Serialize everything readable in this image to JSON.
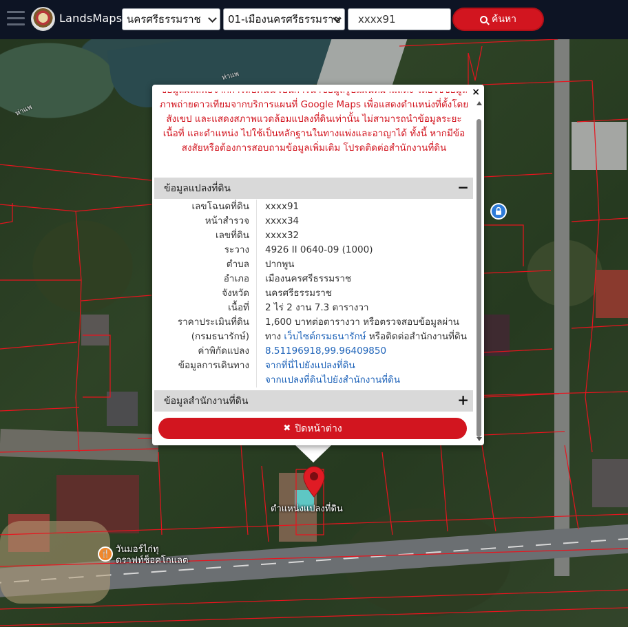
{
  "header": {
    "brand": "LandsMaps",
    "province_select": "นครศรีธรรมราช",
    "amphoe_select": "01-เมืองนครศรีธรรมราช",
    "search_value": "xxxx91",
    "search_button": "ค้นหา"
  },
  "map": {
    "parcel_marker_label": "ตำแหน่งแปลงที่ดิน",
    "poi_food_label_line1": "วันมอร์ไก่ทุ",
    "poi_food_label_line2": "ดราฟท์ช็อคโกแลต",
    "poi_food_icon": "fork-knife-icon",
    "poi_lock_icon": "lock-icon",
    "street_label_1": "ท่าแพ",
    "street_label_2": "ท่าแพ",
    "colors": {
      "parcel_lines": "#e8141e",
      "marker": "#e01b24",
      "poi_food": "#f0882c",
      "poi_blue": "#2e7bd8"
    }
  },
  "popup": {
    "disclaimer": "ข้อมูลผลลัพธ์จากการสืบค้นนี้ เป็นการนำข้อมูลรูปแผนที่มาแสดง โดยใช้ข้อมูลภาพถ่ายดาวเทียมจากบริการแผนที่ Google Maps เพื่อแสดงตำแหน่งที่ตั้งโดยสังเขป และแสดงสภาพแวดล้อมแปลงที่ดินเท่านั้น ไม่สามารถนำข้อมูลระยะ เนื้อที่ และตำแหน่ง ไปใช้เป็นหลักฐานในทางแพ่งและอาญาได้ ทั้งนี้ หากมีข้อสงสัยหรือต้องการสอบถามข้อมูลเพิ่มเติม โปรดติดต่อสำนักงานที่ดิน",
    "section_parcel": "ข้อมูลแปลงที่ดิน",
    "section_parcel_sign": "−",
    "section_office": "ข้อมูลสำนักงานที่ดิน",
    "section_office_sign": "+",
    "close_x": "×",
    "close_button": "ปิดหน้าต่าง",
    "rows": {
      "deed_label": "เลขโฉนดที่ดิน",
      "deed_value": "xxxx91",
      "survey_label": "หน้าสำรวจ",
      "survey_value": "xxxx34",
      "land_no_label": "เลขที่ดิน",
      "land_no_value": "xxxx32",
      "sheet_label": "ระวาง",
      "sheet_value": "4926 II 0640-09 (1000)",
      "tambon_label": "ตำบล",
      "tambon_value": "ปากพูน",
      "amphoe_label": "อำเภอ",
      "amphoe_value": "เมืองนครศรีธรรมราช",
      "province_label": "จังหวัด",
      "province_value": "นครศรีธรรมราช",
      "area_label": "เนื้อที่",
      "area_value": "2 ไร่ 2 งาน 7.3 ตารางวา",
      "price_label": "ราคาประเมินที่ดิน",
      "price_value": "1,600 บาทต่อตารางวา หรือตรวจสอบข้อมูลผ่าน",
      "price_label2": "(กรมธนารักษ์)",
      "price_value2_pre": "ทาง ",
      "price_link": "เว็บไซต์กรมธนารักษ์",
      "price_value2_post": " หรือติดต่อสำนักงานที่ดิน",
      "coord_label": "ค่าพิกัดแปลง",
      "coord_value": "8.51196918,99.96409850",
      "travel_label": "ข้อมูลการเดินทาง",
      "travel_link1": "จากที่นี่ไปยังแปลงที่ดิน",
      "travel_link2": "จากแปลงที่ดินไปยังสำนักงานที่ดิน"
    }
  }
}
